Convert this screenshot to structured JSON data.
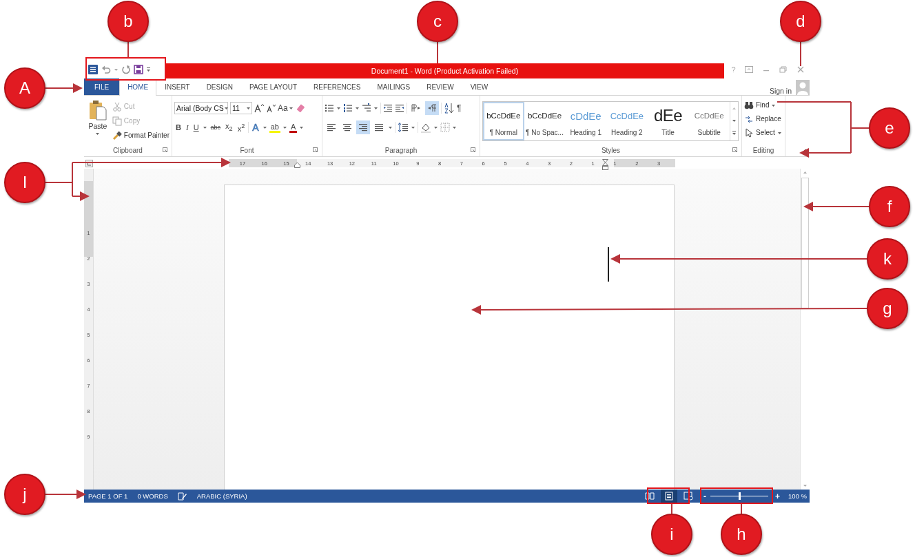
{
  "window": {
    "title": "Document1 -  Word (Product Activation Failed)",
    "help": "?"
  },
  "tabs": [
    {
      "label": "FILE",
      "kind": "file",
      "selected": false
    },
    {
      "label": "HOME",
      "kind": "tab",
      "selected": true
    },
    {
      "label": "INSERT",
      "kind": "tab",
      "selected": false
    },
    {
      "label": "DESIGN",
      "kind": "tab",
      "selected": false
    },
    {
      "label": "PAGE LAYOUT",
      "kind": "tab",
      "selected": false
    },
    {
      "label": "REFERENCES",
      "kind": "tab",
      "selected": false
    },
    {
      "label": "MAILINGS",
      "kind": "tab",
      "selected": false
    },
    {
      "label": "REVIEW",
      "kind": "tab",
      "selected": false
    },
    {
      "label": "VIEW",
      "kind": "tab",
      "selected": false
    }
  ],
  "account": {
    "label": "Sign in"
  },
  "ribbon": [
    {
      "kind": "clipboard",
      "label": "Clipboard",
      "paste": "Paste",
      "items": [
        {
          "label": "Cut",
          "kind": "cut",
          "disabled": true
        },
        {
          "label": "Copy",
          "kind": "copy",
          "disabled": true
        },
        {
          "label": "Format Painter",
          "kind": "painter",
          "disabled": false
        }
      ]
    },
    {
      "kind": "font",
      "label": "Font",
      "font_name": "Arial (Body CS",
      "size_box": "11",
      "change_case": "Aa",
      "format_buttons": [
        {
          "label": "B",
          "kind": "bold"
        },
        {
          "label": "I",
          "kind": "italic"
        },
        {
          "label": "U",
          "kind": "underline"
        },
        {
          "label": "abc",
          "kind": "strike"
        },
        {
          "label": "x$_{2}$",
          "kind": "script"
        },
        {
          "label": "x$^{2}$",
          "kind": "script"
        }
      ],
      "text_effect": "A",
      "highlight": "ab",
      "font_color": "A"
    },
    {
      "kind": "paragraph",
      "label": "Paragraph",
      "directions": [
        {
          "selected": false
        },
        {
          "selected": true
        }
      ],
      "show_marks": "¶",
      "alignments": [
        {
          "selected": false
        },
        {
          "selected": false
        },
        {
          "selected": true
        },
        {
          "selected": false
        }
      ]
    },
    {
      "kind": "styles",
      "label": "Styles",
      "items": [
        {
          "preview": "bCcDdEe",
          "name": "¶ Normal",
          "kind": "normal",
          "selected": true
        },
        {
          "preview": "bCcDdEe",
          "name": "¶ No Spac...",
          "kind": "normal",
          "selected": false
        },
        {
          "preview": "cDdEe",
          "name": "Heading 1",
          "kind": "heading1",
          "selected": false
        },
        {
          "preview": "CcDdEe",
          "name": "Heading 2",
          "kind": "heading2",
          "selected": false
        },
        {
          "preview": "dEe",
          "name": "Title",
          "kind": "title",
          "selected": false
        },
        {
          "preview": "CcDdEe",
          "name": "Subtitle",
          "kind": "subtitle",
          "selected": false
        }
      ]
    },
    {
      "kind": "editing",
      "label": "Editing",
      "items": [
        {
          "label": "Find",
          "kind": "find"
        },
        {
          "label": "Replace",
          "kind": "replace"
        },
        {
          "label": "Select",
          "kind": "select"
        }
      ]
    }
  ],
  "ruler": {
    "numbers": [
      "17",
      "16",
      "15",
      "14",
      "13",
      "12",
      "11",
      "10",
      "9",
      "8",
      "7",
      "6",
      "5",
      "4",
      "3",
      "2",
      "1",
      "1",
      "2",
      "3"
    ]
  },
  "vertical_ruler": {
    "numbers": [
      "1",
      "2",
      "3",
      "4",
      "5",
      "6",
      "7",
      "8",
      "9"
    ]
  },
  "status_bar": {
    "page": "PAGE 1 OF 1",
    "words": "0 WORDS",
    "language": "ARABIC (SYRIA)",
    "views": [
      {
        "kind": "read",
        "selected": false
      },
      {
        "kind": "print",
        "selected": true
      },
      {
        "kind": "web",
        "selected": false
      }
    ],
    "zoom_out": "-",
    "zoom": {
      "level": 0.5
    },
    "zoom_in": "+",
    "zoom_reading": "100 %"
  },
  "annotations": [
    {
      "label": "b"
    },
    {
      "label": "c"
    },
    {
      "label": "d"
    },
    {
      "label": "A"
    },
    {
      "label": "e"
    },
    {
      "label": "I"
    },
    {
      "label": "f"
    },
    {
      "label": "k"
    },
    {
      "label": "g"
    },
    {
      "label": "j"
    },
    {
      "label": "i"
    },
    {
      "label": "h"
    }
  ]
}
